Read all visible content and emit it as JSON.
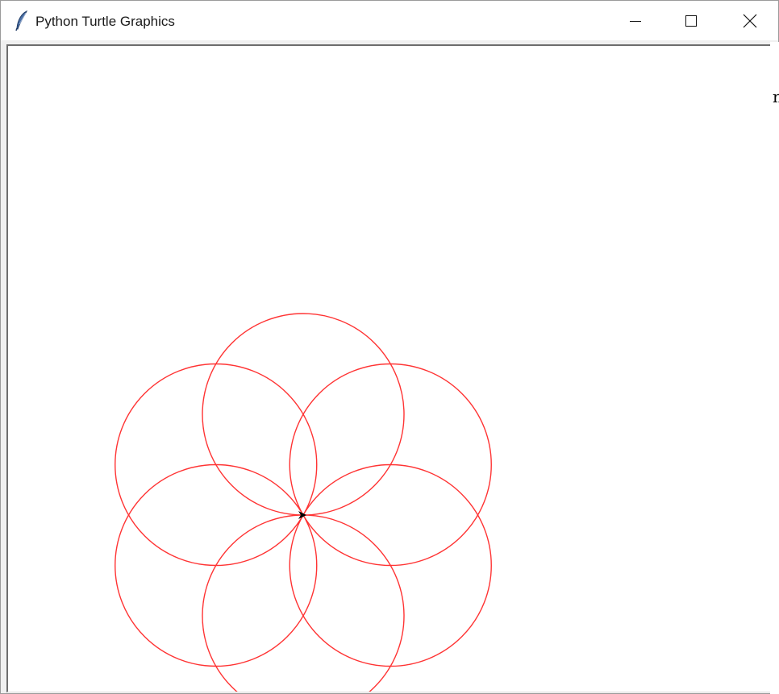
{
  "window": {
    "title": "Python Turtle Graphics",
    "icon": "feather-icon",
    "controls": {
      "minimize_icon": "minimize-icon",
      "maximize_icon": "maximize-icon",
      "close_icon": "close-icon"
    }
  },
  "canvas": {
    "background": "#ffffff",
    "pen_color": "#ff3333",
    "turtle_color": "#000000",
    "drawing": {
      "shape": "circle",
      "count": 6,
      "radius": 125,
      "rotation_step_degrees": 60,
      "turtle_heading_degrees": 0
    }
  },
  "background_window": {
    "visible_fragment": "n"
  }
}
